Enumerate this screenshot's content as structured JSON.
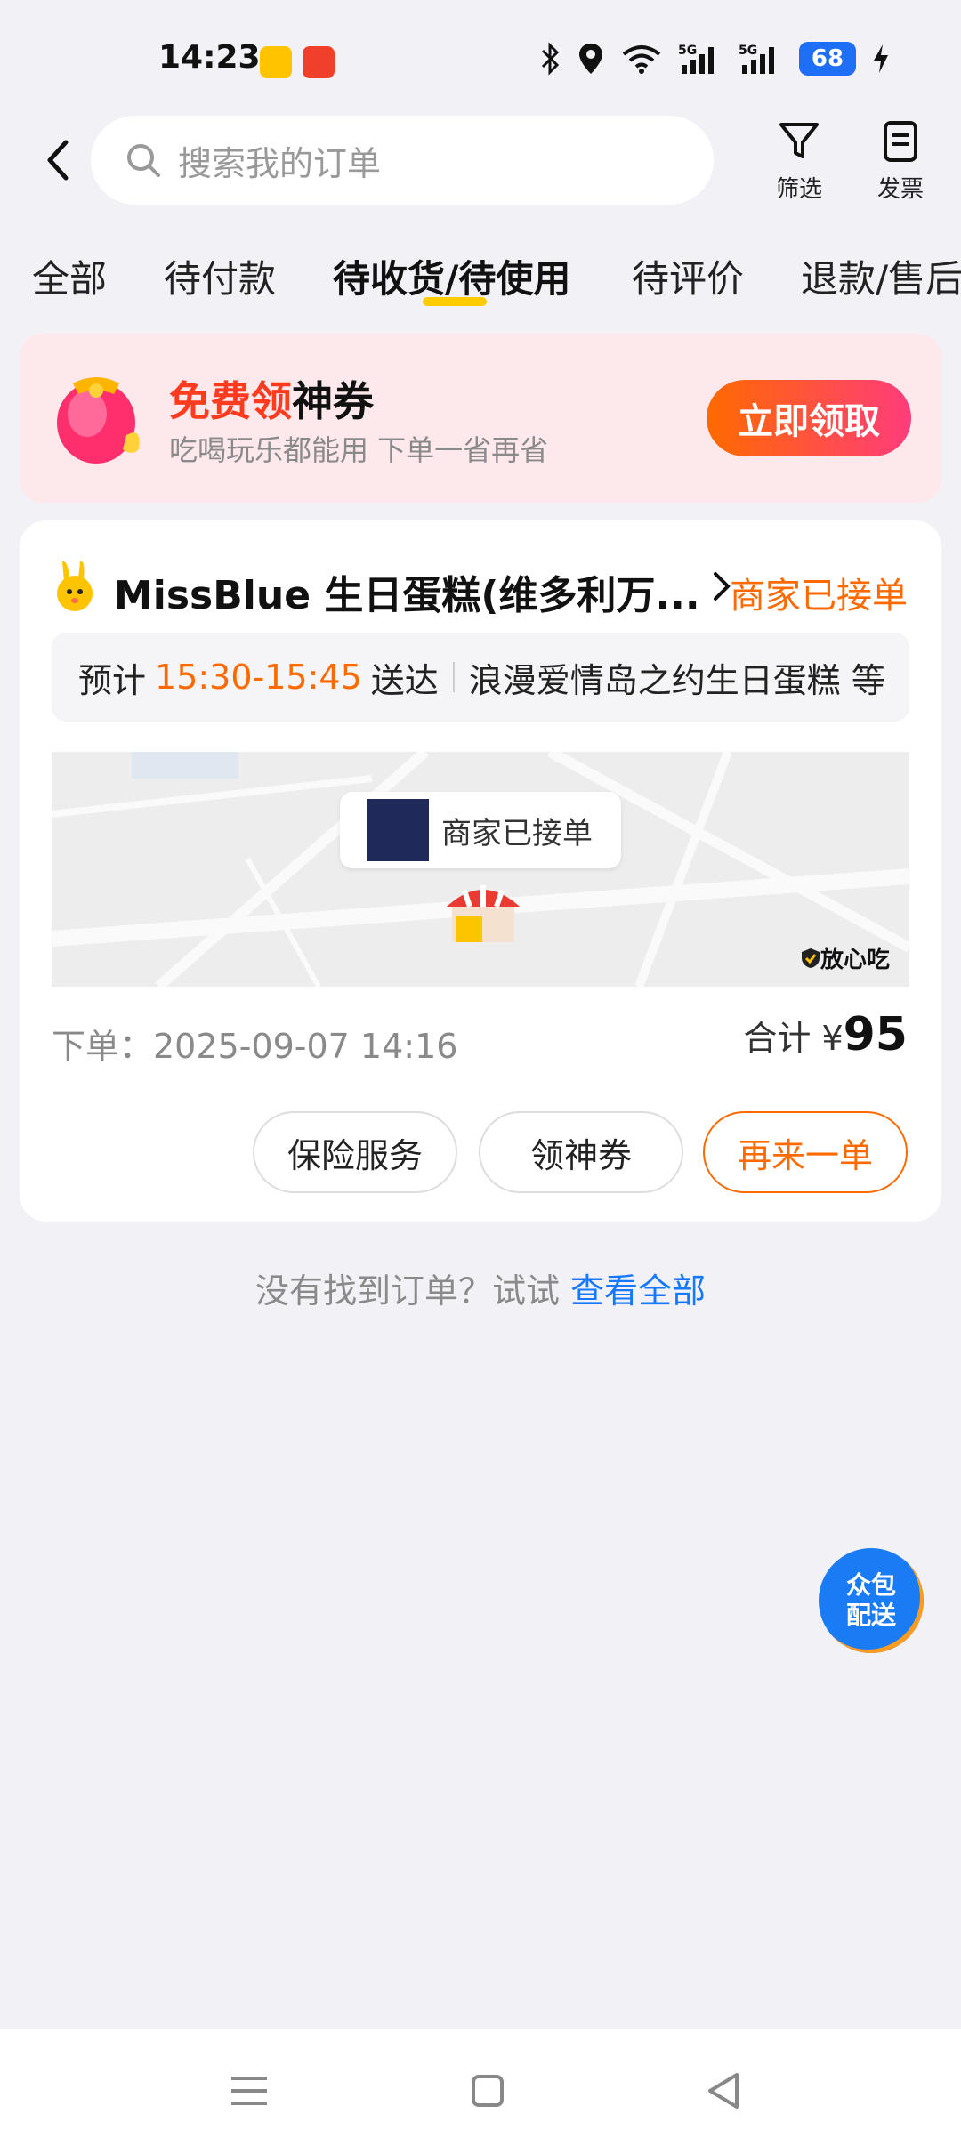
{
  "status_bar": {
    "time": "14:23",
    "battery": "68"
  },
  "search": {
    "placeholder": "搜索我的订单"
  },
  "top_actions": {
    "filter": "筛选",
    "invoice": "发票"
  },
  "tabs": [
    {
      "label": "全部"
    },
    {
      "label": "待付款"
    },
    {
      "label": "待收货/待使用",
      "active": true
    },
    {
      "label": "待评价"
    },
    {
      "label": "退款/售后"
    }
  ],
  "promo": {
    "title_highlight": "免费领",
    "title_rest": "神券",
    "subtitle": "吃喝玩乐都能用 下单一省再省",
    "button": "立即领取"
  },
  "order": {
    "shop_name": "MissBlue 生日蛋糕(维多利万...",
    "status": "商家已接单",
    "eta_prefix": "预计",
    "eta_time": "15:30-15:45",
    "eta_suffix": "送达",
    "items": "浪漫爱情岛之约生日蛋糕 等",
    "map_bubble": "商家已接单",
    "map_badge": "放心吃",
    "order_time": "下单：2025-09-07 14:16",
    "total_label": "合计",
    "total_currency": "¥",
    "total_value": "95",
    "buttons": {
      "insurance": "保险服务",
      "coupon": "领神券",
      "reorder": "再来一单"
    }
  },
  "empty_hint": {
    "text": "没有找到订单？试试",
    "link": "查看全部"
  },
  "float_button": {
    "line1": "众包",
    "line2": "配送"
  },
  "colors": {
    "accent": "#ff6a00",
    "link": "#1677ff",
    "tab_underline": "#ffcc00"
  }
}
